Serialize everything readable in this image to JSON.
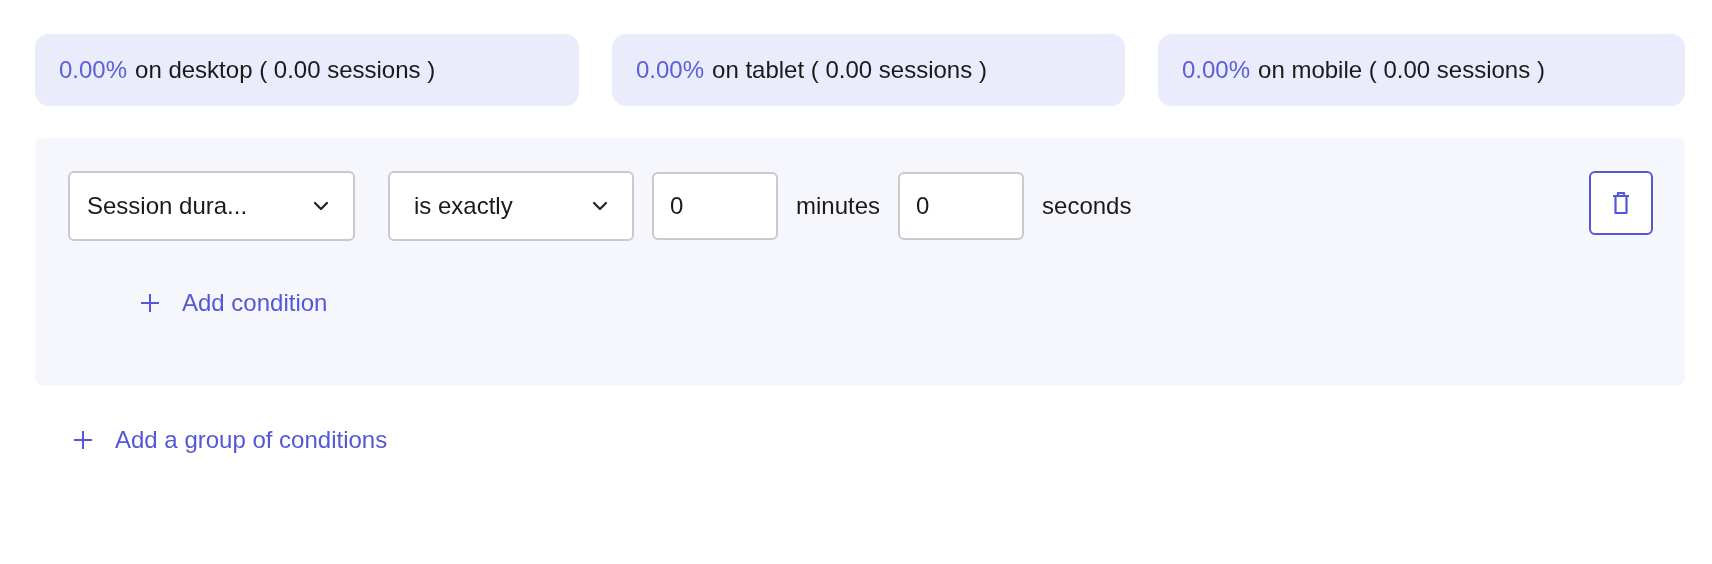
{
  "device_stats": [
    {
      "percent": "0.00%",
      "label": "on desktop ( 0.00 sessions )"
    },
    {
      "percent": "0.00%",
      "label": "on tablet ( 0.00 sessions )"
    },
    {
      "percent": "0.00%",
      "label": "on mobile ( 0.00 sessions )"
    }
  ],
  "condition_group": {
    "conditions": [
      {
        "parts": [
          {
            "kind": "select",
            "value": "Session dura..."
          },
          {
            "kind": "select",
            "value": "is exactly"
          },
          {
            "kind": "input",
            "value": "0"
          },
          {
            "kind": "text",
            "value": "minutes"
          },
          {
            "kind": "input",
            "value": "0"
          },
          {
            "kind": "text",
            "value": "seconds"
          }
        ]
      }
    ],
    "add_condition": "Add condition"
  },
  "add_group": "Add a group of conditions"
}
